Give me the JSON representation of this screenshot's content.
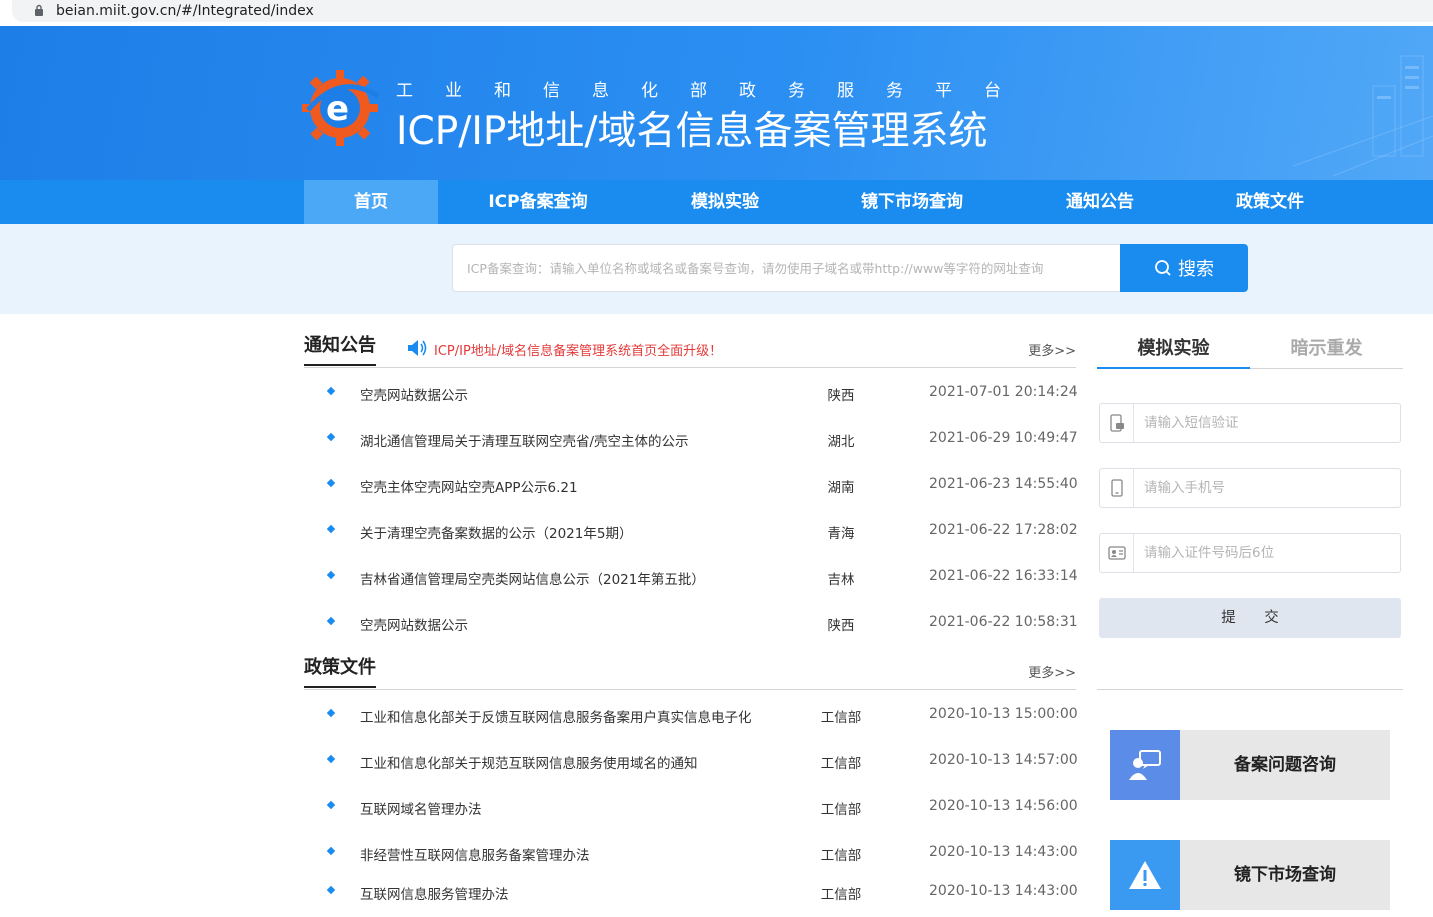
{
  "browser": {
    "url": "beian.miit.gov.cn/#/Integrated/index"
  },
  "header": {
    "subtitle": "工业和信息化部政务服务平台",
    "title": "ICP/IP地址/域名信息备案管理系统"
  },
  "nav": [
    {
      "label": "首页",
      "active": true
    },
    {
      "label": "ICP备案查询"
    },
    {
      "label": "模拟实验"
    },
    {
      "label": "镜下市场查询"
    },
    {
      "label": "通知公告"
    },
    {
      "label": "政策文件"
    }
  ],
  "search": {
    "placeholder": "ICP备案查询：请输入单位名称或域名或备案号查询，请勿使用子域名或带http://www等字符的网址查询",
    "button": "搜索"
  },
  "notice": {
    "title": "通知公告",
    "marquee": "ICP/IP地址/域名信息备案管理系统首页全面升级！",
    "more": "更多>>",
    "items": [
      {
        "title": "空壳网站数据公示",
        "region": "陕西",
        "date": "2021-07-01 20:14:24"
      },
      {
        "title": "湖北通信管理局关于清理互联网空壳省/壳空主体的公示",
        "region": "湖北",
        "date": "2021-06-29 10:49:47"
      },
      {
        "title": "空壳主体空壳网站空壳APP公示6.21",
        "region": "湖南",
        "date": "2021-06-23 14:55:40"
      },
      {
        "title": "关于清理空壳备案数据的公示（2021年5期）",
        "region": "青海",
        "date": "2021-06-22 17:28:02"
      },
      {
        "title": "吉林省通信管理局空壳类网站信息公示（2021年第五批）",
        "region": "吉林",
        "date": "2021-06-22 16:33:14"
      },
      {
        "title": "空壳网站数据公示",
        "region": "陕西",
        "date": "2021-06-22 10:58:31"
      }
    ]
  },
  "policy": {
    "title": "政策文件",
    "more": "更多>>",
    "items": [
      {
        "title": "工业和信息化部关于反馈互联网信息服务备案用户真实信息电子化",
        "region": "工信部",
        "date": "2020-10-13 15:00:00"
      },
      {
        "title": "工业和信息化部关于规范互联网信息服务使用域名的通知",
        "region": "工信部",
        "date": "2020-10-13 14:57:00"
      },
      {
        "title": "互联网域名管理办法",
        "region": "工信部",
        "date": "2020-10-13 14:56:00"
      },
      {
        "title": "非经营性互联网信息服务备案管理办法",
        "region": "工信部",
        "date": "2020-10-13 14:43:00"
      },
      {
        "title": "互联网信息服务管理办法",
        "region": "工信部",
        "date": "2020-10-13 14:43:00"
      }
    ]
  },
  "side": {
    "tabs": [
      {
        "label": "模拟实验",
        "active": true
      },
      {
        "label": "暗示重发"
      }
    ],
    "fields": [
      {
        "placeholder": "请输入短信验证",
        "icon": "sms-icon"
      },
      {
        "placeholder": "请输入手机号",
        "icon": "phone-icon"
      },
      {
        "placeholder": "请输入证件号码后6位",
        "icon": "id-card-icon"
      }
    ],
    "submit": "提 交",
    "quick": [
      {
        "label": "备案问题咨询",
        "icon": "consult-icon",
        "color": "#5b8de8"
      },
      {
        "label": "镜下市场查询",
        "icon": "warning-icon",
        "color": "#3a9af2"
      }
    ]
  }
}
